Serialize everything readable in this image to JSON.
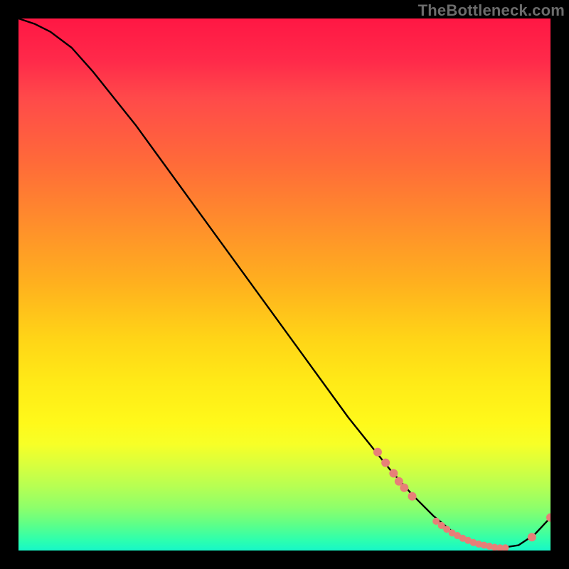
{
  "watermark": "TheBottleneck.com",
  "chart_data": {
    "type": "line",
    "title": "",
    "xlabel": "",
    "ylabel": "",
    "xlim": [
      0,
      100
    ],
    "ylim": [
      0,
      100
    ],
    "grid": false,
    "legend": false,
    "series": [
      {
        "name": "bottleneck-curve",
        "x": [
          0,
          3,
          6,
          10,
          14,
          18,
          22,
          26,
          30,
          34,
          38,
          42,
          46,
          50,
          54,
          58,
          62,
          66,
          70,
          74,
          78,
          82,
          86,
          90,
          94,
          97,
          100
        ],
        "y": [
          100,
          99,
          97.5,
          94.5,
          90,
          85,
          80,
          74.5,
          69,
          63.5,
          58,
          52.5,
          47,
          41.5,
          36,
          30.5,
          25,
          20,
          15,
          10.5,
          6.5,
          3.2,
          1.3,
          0.4,
          1.0,
          3.0,
          6.2
        ],
        "color": "#000000"
      }
    ],
    "markers": [
      {
        "name": "cluster-upper",
        "color": "#e77f78",
        "points": [
          {
            "x": 67.5,
            "y": 18.5
          },
          {
            "x": 69.0,
            "y": 16.5
          },
          {
            "x": 70.5,
            "y": 14.5
          },
          {
            "x": 71.5,
            "y": 13.0
          },
          {
            "x": 72.5,
            "y": 11.8
          },
          {
            "x": 74.0,
            "y": 10.2
          }
        ],
        "radius": 6
      },
      {
        "name": "cluster-bottom",
        "color": "#e77f78",
        "points": [
          {
            "x": 78.5,
            "y": 5.5
          },
          {
            "x": 79.5,
            "y": 4.7
          },
          {
            "x": 80.5,
            "y": 4.0
          },
          {
            "x": 81.5,
            "y": 3.3
          },
          {
            "x": 82.5,
            "y": 2.8
          },
          {
            "x": 83.5,
            "y": 2.3
          },
          {
            "x": 84.5,
            "y": 1.9
          },
          {
            "x": 85.5,
            "y": 1.5
          },
          {
            "x": 86.5,
            "y": 1.2
          },
          {
            "x": 87.5,
            "y": 1.0
          },
          {
            "x": 88.5,
            "y": 0.8
          },
          {
            "x": 89.5,
            "y": 0.6
          },
          {
            "x": 90.5,
            "y": 0.5
          },
          {
            "x": 91.5,
            "y": 0.5
          }
        ],
        "radius": 5
      },
      {
        "name": "cluster-rise",
        "color": "#e77f78",
        "points": [
          {
            "x": 96.5,
            "y": 2.5
          },
          {
            "x": 100,
            "y": 6.2
          }
        ],
        "radius": 6
      }
    ]
  }
}
